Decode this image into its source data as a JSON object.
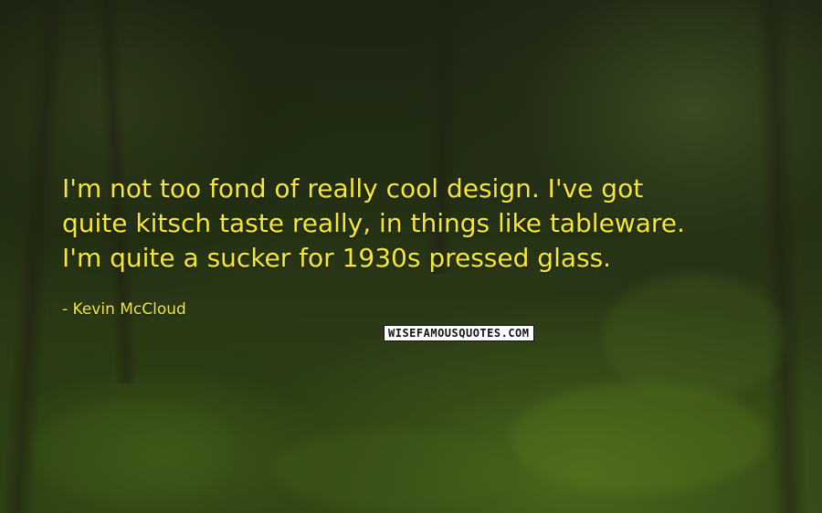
{
  "quote": {
    "lines": [
      "I'm not too fond of really cool design. I've got",
      "quite kitsch taste really, in things like tableware.",
      "I'm quite a sucker for 1930s pressed glass."
    ]
  },
  "author": "- Kevin McCloud",
  "brand": "WISEFAMOUSQUOTES.COM",
  "colors": {
    "text": "#f4e63a",
    "background": "#2a3816"
  }
}
